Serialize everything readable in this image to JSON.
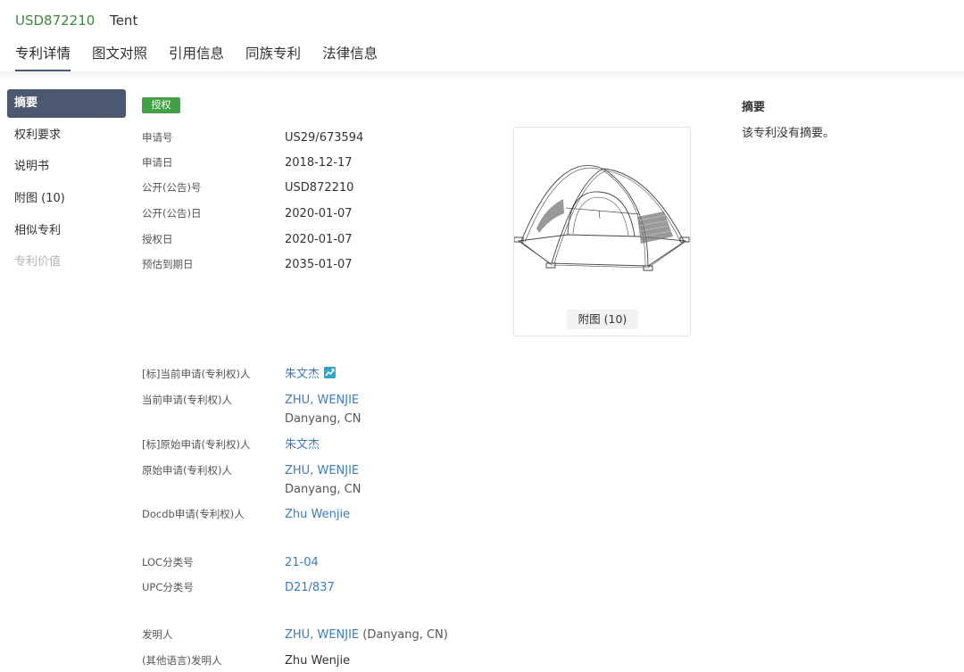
{
  "header": {
    "patent_number": "USD872210",
    "title": "Tent"
  },
  "tabs": [
    {
      "label": "专利详情"
    },
    {
      "label": "图文对照"
    },
    {
      "label": "引用信息"
    },
    {
      "label": "同族专利"
    },
    {
      "label": "法律信息"
    }
  ],
  "active_tab": "专利详情",
  "sidebar": {
    "items": [
      {
        "label": "摘要"
      },
      {
        "label": "权利要求"
      },
      {
        "label": "说明书"
      },
      {
        "label": "附图 (10)"
      },
      {
        "label": "相似专利"
      },
      {
        "label": "专利价值"
      }
    ],
    "active_item": "摘要",
    "disabled_item": "专利价值"
  },
  "status_badge": "授权",
  "basic_info": [
    {
      "label": "申请号",
      "value": "US29/673594"
    },
    {
      "label": "申请日",
      "value": "2018-12-17"
    },
    {
      "label": "公开(公告)号",
      "value": "USD872210"
    },
    {
      "label": "公开(公告)日",
      "value": "2020-01-07"
    },
    {
      "label": "授权日",
      "value": "2020-01-07"
    },
    {
      "label": "预估到期日",
      "value": "2035-01-07"
    }
  ],
  "figure": {
    "button_label": "附图 (10)"
  },
  "parties": {
    "std_current_applicant": {
      "label": "[标]当前申请(专利权)人",
      "value": "朱文杰"
    },
    "current_applicant": {
      "label": "当前申请(专利权)人",
      "value": "ZHU, WENJIE",
      "location": "Danyang, CN"
    },
    "std_original_applicant": {
      "label": "[标]原始申请(专利权)人",
      "value": "朱文杰"
    },
    "original_applicant": {
      "label": "原始申请(专利权)人",
      "value": "ZHU, WENJIE",
      "location": "Danyang, CN"
    },
    "docdb_applicant": {
      "label": "Docdb申请(专利权)人",
      "value": "Zhu Wenjie"
    }
  },
  "classification": {
    "loc": {
      "label": "LOC分类号",
      "value": "21-04"
    },
    "upc": {
      "label": "UPC分类号",
      "value": "D21/837"
    }
  },
  "inventors": {
    "inventor": {
      "label": "发明人",
      "value": "ZHU, WENJIE",
      "suffix": "(Danyang, CN)"
    },
    "other_lang_inventor": {
      "label": "(其他语言)发明人",
      "value": "Zhu Wenjie"
    }
  },
  "abstract": {
    "title": "摘要",
    "text": "该专利没有摘要。"
  },
  "colors": {
    "accent": "#4b5870",
    "badge": "#43a047",
    "link": "#3c7ac5",
    "patent_number": "#3a8a3a"
  },
  "icons": {
    "trend": "trend-chart-icon"
  }
}
